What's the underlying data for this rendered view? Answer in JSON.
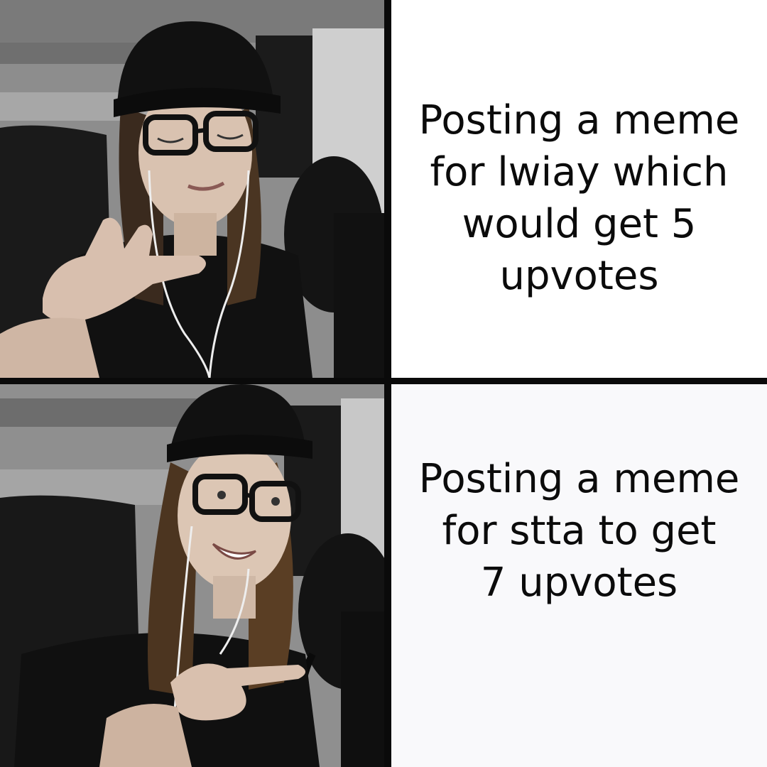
{
  "panels": {
    "top": {
      "photo_icon": "woman-rejecting-gesture-photo",
      "caption_lines": [
        "Posting a meme",
        "for lwiay which",
        "would get 5",
        "upvotes"
      ]
    },
    "bottom": {
      "photo_icon": "woman-pointing-approval-photo",
      "caption_lines": [
        "Posting a meme",
        "for stta to get",
        "7 upvotes"
      ]
    }
  },
  "colors": {
    "divider": "#0a0a0a",
    "caption_background": "#ffffff",
    "caption_text": "#0b0b0b"
  }
}
